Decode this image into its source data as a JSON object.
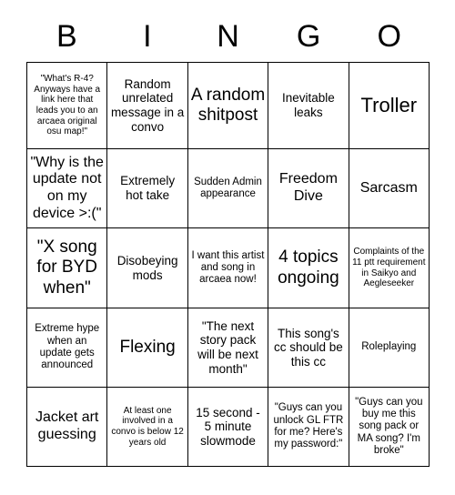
{
  "header": {
    "letters": [
      "B",
      "I",
      "N",
      "G",
      "O"
    ]
  },
  "grid": {
    "rows": [
      [
        {
          "text": "\"What's R-4? Anyways have a link here that leads you to an arcaea original osu map!\"",
          "size": "xs"
        },
        {
          "text": "Random unrelated message in a convo",
          "size": "m"
        },
        {
          "text": "A random shitpost",
          "size": "xl"
        },
        {
          "text": "Inevitable leaks",
          "size": "m"
        },
        {
          "text": "Troller",
          "size": "xxl"
        }
      ],
      [
        {
          "text": "\"Why is the update not on my device >:(\"",
          "size": "l"
        },
        {
          "text": "Extremely hot take",
          "size": "m"
        },
        {
          "text": "Sudden Admin appearance",
          "size": "s"
        },
        {
          "text": "Freedom Dive",
          "size": "l"
        },
        {
          "text": "Sarcasm",
          "size": "l"
        }
      ],
      [
        {
          "text": "\"X song for BYD when\"",
          "size": "xl"
        },
        {
          "text": "Disobeying mods",
          "size": "m"
        },
        {
          "text": "I want this artist and song in arcaea now!",
          "size": "s"
        },
        {
          "text": "4 topics ongoing",
          "size": "xl"
        },
        {
          "text": "Complaints of the 11 ptt requirement in Saikyo and Aegleseeker",
          "size": "xs"
        }
      ],
      [
        {
          "text": "Extreme hype when an update gets announced",
          "size": "s"
        },
        {
          "text": "Flexing",
          "size": "xl"
        },
        {
          "text": "\"The next story pack will be next month\"",
          "size": "m"
        },
        {
          "text": "This song's cc should be this cc",
          "size": "m"
        },
        {
          "text": "Roleplaying",
          "size": "s"
        }
      ],
      [
        {
          "text": "Jacket art guessing",
          "size": "l"
        },
        {
          "text": "At least one involved in a convo is below 12 years old",
          "size": "xs"
        },
        {
          "text": "15 second - 5 minute slowmode",
          "size": "m"
        },
        {
          "text": "\"Guys can you unlock GL FTR for me? Here's my password:\"",
          "size": "s"
        },
        {
          "text": "\"Guys can you buy me this song pack or MA song? I'm broke\"",
          "size": "s"
        }
      ]
    ]
  }
}
